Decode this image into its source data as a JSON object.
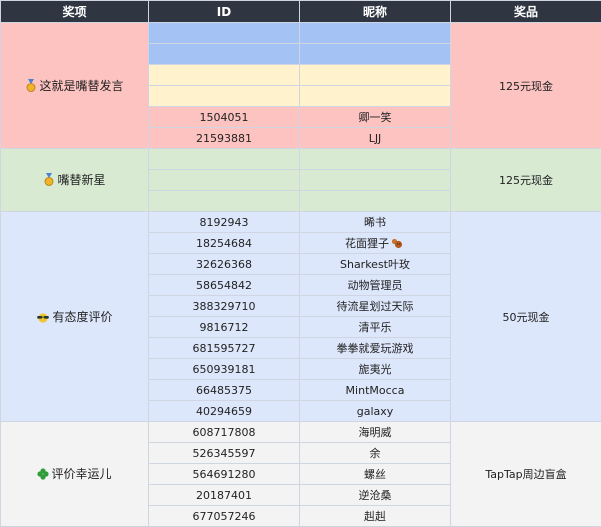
{
  "headers": {
    "award": "奖项",
    "id": "ID",
    "nickname": "昵称",
    "prize": "奖品"
  },
  "colors": {
    "group1_bg": "#fcc3c1",
    "group1_blue": "#a4c2f4",
    "group1_cream": "#fff2cc",
    "group2_bg": "#d9ead3",
    "group3_bg": "#dde7fb",
    "group4_bg": "#f3f3f3"
  },
  "groups": [
    {
      "award": "这就是嘴替发言",
      "icon": "medal-icon",
      "prize": "125元现金",
      "rows": [
        {
          "id": "",
          "nickname": ""
        },
        {
          "id": "",
          "nickname": ""
        },
        {
          "id": "",
          "nickname": ""
        },
        {
          "id": "",
          "nickname": ""
        },
        {
          "id": "1504051",
          "nickname": "卿一笑"
        },
        {
          "id": "21593881",
          "nickname": "LJJ"
        }
      ]
    },
    {
      "award": "嘴替新星",
      "icon": "medal-icon",
      "prize": "125元现金",
      "rows": [
        {
          "id": "",
          "nickname": ""
        },
        {
          "id": "",
          "nickname": ""
        },
        {
          "id": "",
          "nickname": ""
        }
      ]
    },
    {
      "award": "有态度评价",
      "icon": "sunglasses-icon",
      "prize": "50元现金",
      "rows": [
        {
          "id": "8192943",
          "nickname": "晞书"
        },
        {
          "id": "18254684",
          "nickname": "花面狸子"
        },
        {
          "id": "32626368",
          "nickname": "Sharkest叶玫"
        },
        {
          "id": "58654842",
          "nickname": "动物管理员"
        },
        {
          "id": "388329710",
          "nickname": "待流星划过天际"
        },
        {
          "id": "9816712",
          "nickname": "清平乐"
        },
        {
          "id": "681595727",
          "nickname": "拳拳就爱玩游戏"
        },
        {
          "id": "650939181",
          "nickname": "旎夷光"
        },
        {
          "id": "66485375",
          "nickname": "MintMocca"
        },
        {
          "id": "40294659",
          "nickname": "galaxy"
        }
      ]
    },
    {
      "award": "评价幸运儿",
      "icon": "clover-icon",
      "prize": "TapTap周边盲盒",
      "rows": [
        {
          "id": "608717808",
          "nickname": "海明威"
        },
        {
          "id": "526345597",
          "nickname": "余"
        },
        {
          "id": "564691280",
          "nickname": "螺丝"
        },
        {
          "id": "20187401",
          "nickname": "逆沧桑"
        },
        {
          "id": "677057246",
          "nickname": "赳赳"
        }
      ]
    }
  ]
}
